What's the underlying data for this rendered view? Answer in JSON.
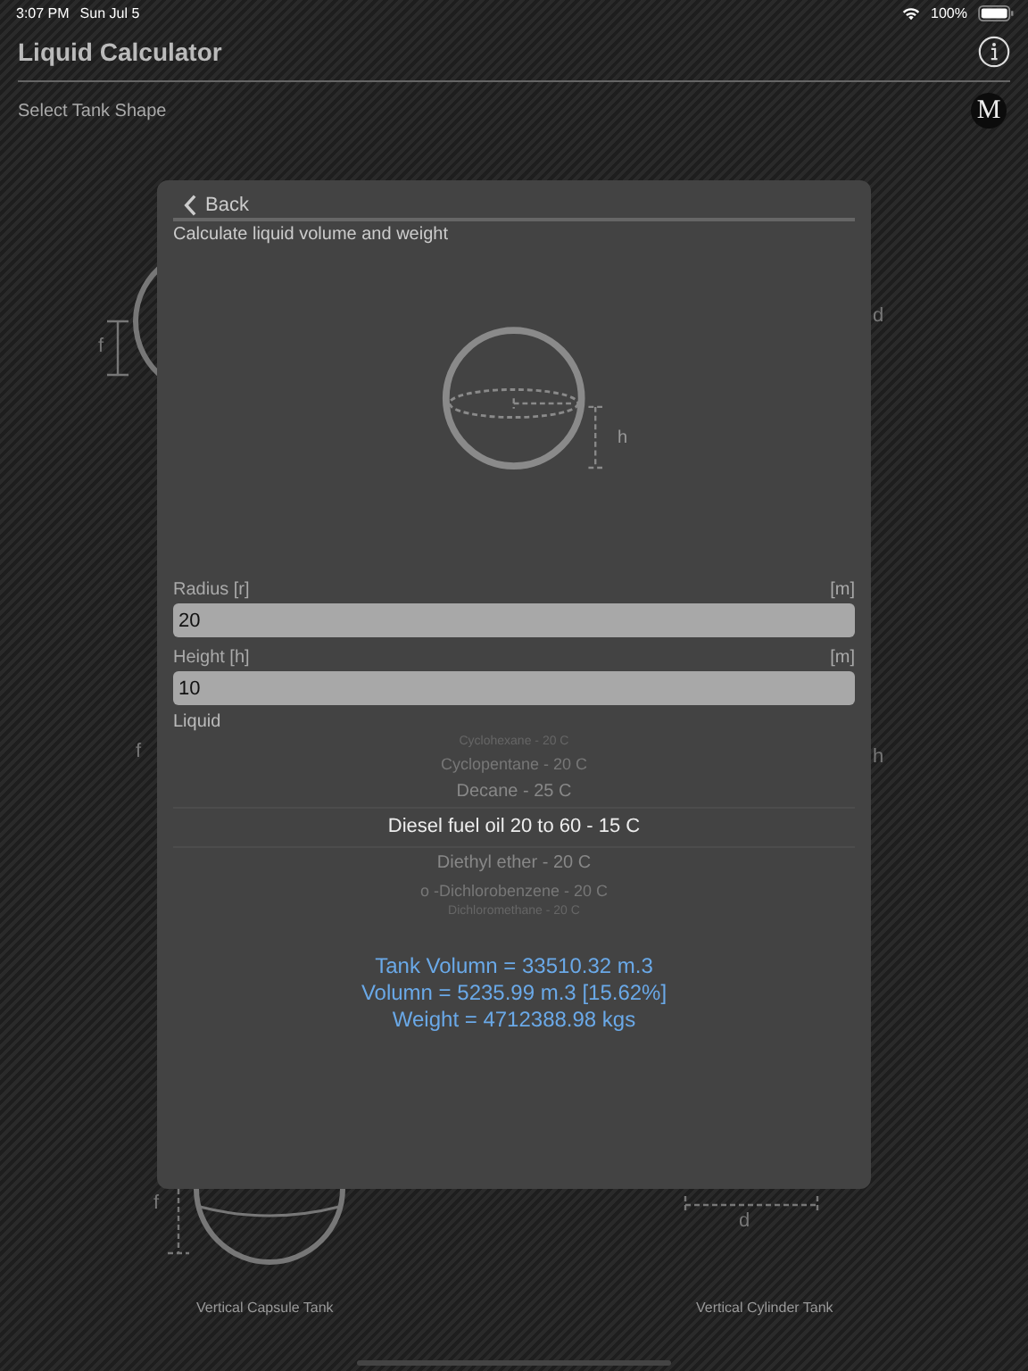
{
  "status_bar": {
    "time": "3:07 PM",
    "date": "Sun Jul 5",
    "battery": "100%"
  },
  "header": {
    "title": "Liquid Calculator",
    "subtitle": "Select Tank Shape",
    "menu_glyph": "M"
  },
  "background": {
    "dimension_labels": [
      "f",
      "d",
      "f",
      "h",
      "f",
      "d"
    ],
    "tank_names": [
      "Vertical Capsule Tank",
      "Vertical Cylinder Tank"
    ]
  },
  "dialog": {
    "back": "Back",
    "heading": "Calculate liquid volume and weight",
    "diagram_label": "h",
    "fields": [
      {
        "label": "Radius [r]",
        "unit": "[m]",
        "value": "20"
      },
      {
        "label": "Height [h]",
        "unit": "[m]",
        "value": "10"
      }
    ],
    "liquid_label": "Liquid",
    "liquids": [
      {
        "name": "Cyclohexane - 20 C",
        "selected": false
      },
      {
        "name": "Cyclopentane - 20 C",
        "selected": false
      },
      {
        "name": "Decane - 25 C",
        "selected": false
      },
      {
        "name": "Diesel fuel oil 20 to 60 - 15 C",
        "selected": true
      },
      {
        "name": "Diethyl ether - 20 C",
        "selected": false
      },
      {
        "name": "o -Dichlorobenzene - 20 C",
        "selected": false
      },
      {
        "name": "Dichloromethane - 20 C",
        "selected": false
      }
    ],
    "results": [
      "Tank Volumn = 33510.32 m.3",
      "Volumn = 5235.99 m.3 [15.62%]",
      "Weight = 4712388.98 kgs"
    ]
  }
}
